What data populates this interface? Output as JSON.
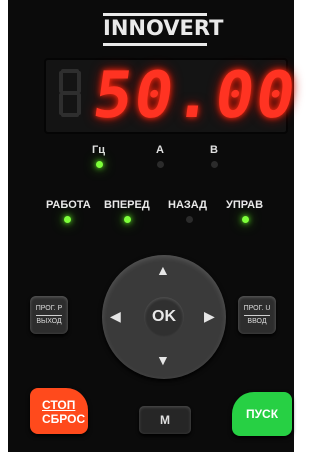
{
  "brand": "INNOVERT",
  "display": {
    "value": "50.00",
    "ghost_digit": "8"
  },
  "units": [
    {
      "label": "Гц",
      "state": "on"
    },
    {
      "label": "A",
      "state": "off"
    },
    {
      "label": "B",
      "state": "off"
    }
  ],
  "status": [
    {
      "label": "РАБОТА",
      "state": "on"
    },
    {
      "label": "ВПЕРЕД",
      "state": "on"
    },
    {
      "label": "НАЗАД",
      "state": "off"
    },
    {
      "label": "УПРАВ",
      "state": "on"
    }
  ],
  "keys": {
    "left": {
      "top": "ПРОГ. Р",
      "bottom": "ВЫХОД"
    },
    "right": {
      "top": "ПРОГ. U",
      "bottom": "ВВОД"
    },
    "ok": "OK",
    "stop": {
      "line1": "СТОП",
      "line2": "СБРОС"
    },
    "m": "M",
    "run": "ПУСК"
  },
  "colors": {
    "led_on": "#7dff3a",
    "display": "#ff3322",
    "stop": "#ff4a1c",
    "run": "#27d044"
  }
}
